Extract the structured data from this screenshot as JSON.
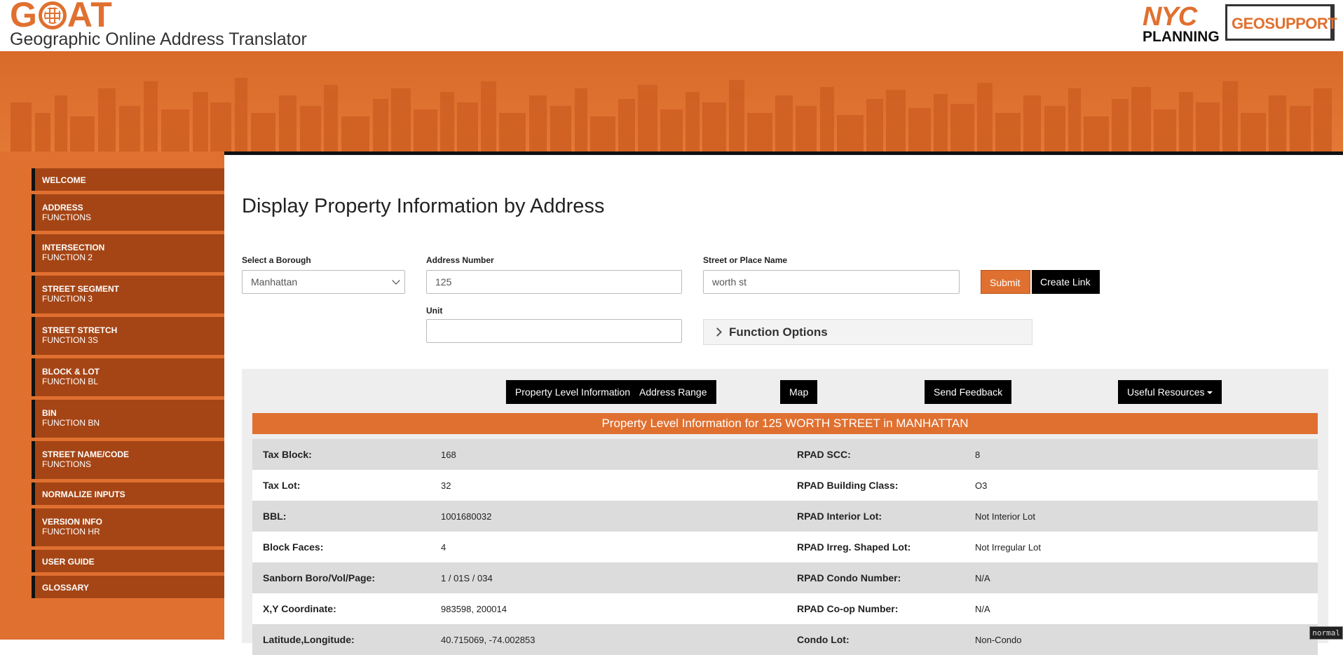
{
  "header": {
    "logo": "GOAT",
    "subtitle": "Geographic Online Address Translator",
    "partner_nyc": "NYC",
    "partner_planning": "PLANNING",
    "partner_geosupport": "GEOSUPPORT"
  },
  "sidebar": {
    "items": [
      {
        "label": "WELCOME",
        "sub": ""
      },
      {
        "label": "ADDRESS",
        "sub": "FUNCTIONS"
      },
      {
        "label": "INTERSECTION",
        "sub": "FUNCTION 2"
      },
      {
        "label": "STREET SEGMENT",
        "sub": "FUNCTION 3"
      },
      {
        "label": "STREET STRETCH",
        "sub": "FUNCTION 3S"
      },
      {
        "label": "BLOCK & LOT",
        "sub": "FUNCTION BL"
      },
      {
        "label": "BIN",
        "sub": "FUNCTION BN"
      },
      {
        "label": "STREET NAME/CODE",
        "sub": "FUNCTIONS"
      },
      {
        "label": "NORMALIZE INPUTS",
        "sub": ""
      },
      {
        "label": "VERSION INFO",
        "sub": "FUNCTION HR"
      },
      {
        "label": "USER GUIDE",
        "sub": ""
      },
      {
        "label": "GLOSSARY",
        "sub": ""
      }
    ]
  },
  "form": {
    "title": "Display Property Information by Address",
    "borough_label": "Select a Borough",
    "borough_value": "Manhattan",
    "address_number_label": "Address Number",
    "address_number_value": "125",
    "street_label": "Street or Place Name",
    "street_value": "worth st",
    "unit_label": "Unit",
    "unit_value": "",
    "submit_label": "Submit",
    "create_link_label": "Create Link",
    "function_options_label": "Function Options"
  },
  "results": {
    "tabs": [
      "Property Level Information",
      "Address Range",
      "Map",
      "Send Feedback",
      "Useful Resources"
    ],
    "header": "Property Level Information for 125 WORTH STREET in MANHATTAN",
    "rows": [
      {
        "k1": "Tax Block:",
        "v1": "168",
        "k2": "RPAD SCC:",
        "v2": "8"
      },
      {
        "k1": "Tax Lot:",
        "v1": "32",
        "k2": "RPAD Building Class:",
        "v2": "O3"
      },
      {
        "k1": "BBL:",
        "v1": "1001680032",
        "k2": "RPAD Interior Lot:",
        "v2": "Not Interior Lot"
      },
      {
        "k1": "Block Faces:",
        "v1": "4",
        "k2": "RPAD Irreg. Shaped Lot:",
        "v2": "Not Irregular Lot"
      },
      {
        "k1": "Sanborn Boro/Vol/Page:",
        "v1": "1 / 01S / 034",
        "k2": "RPAD Condo Number:",
        "v2": "N/A"
      },
      {
        "k1": "X,Y Coordinate:",
        "v1": "983598, 200014",
        "k2": "RPAD Co-op Number:",
        "v2": "N/A"
      },
      {
        "k1": "Latitude,Longitude:",
        "v1": "40.715069, -74.002853",
        "k2": "Condo Lot:",
        "v2": "Non-Condo"
      }
    ]
  },
  "status_mode": "normal",
  "colors": {
    "brand_orange": "#e07030",
    "sidebar_item": "#a54515",
    "black": "#000000"
  }
}
